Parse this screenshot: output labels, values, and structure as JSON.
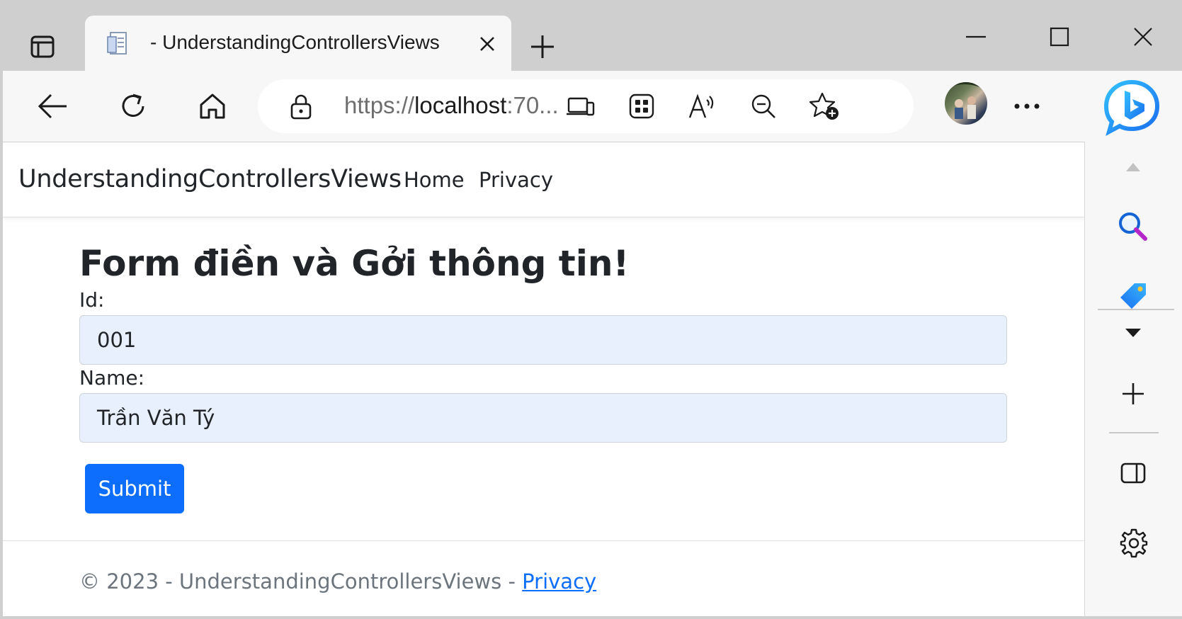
{
  "browser": {
    "tab_title": "- UnderstandingControllersViews",
    "url_scheme": "https://",
    "url_host": "localhost",
    "url_port": ":70...",
    "icons": {
      "tab_actions": "tab-actions-icon",
      "close_tab": "close-icon",
      "new_tab": "plus-icon",
      "minimize": "minimize-icon",
      "maximize": "maximize-icon",
      "close_window": "close-icon",
      "back": "back-arrow-icon",
      "refresh": "refresh-icon",
      "home": "home-icon",
      "lock": "lock-icon",
      "devices": "devices-icon",
      "apps": "apps-grid-icon",
      "read_aloud": "read-aloud-icon",
      "zoom_out": "zoom-out-icon",
      "add_favorite": "add-favorite-icon",
      "more": "more-icon",
      "copilot": "bing-copilot-icon"
    }
  },
  "site": {
    "brand": "UnderstandingControllersViews",
    "nav": [
      {
        "label": "Home"
      },
      {
        "label": "Privacy"
      }
    ]
  },
  "form": {
    "heading": "Form điền và Gởi thông tin!",
    "id_label": "Id:",
    "id_value": "001",
    "name_label": "Name:",
    "name_value": "Trần Văn Tý",
    "submit_label": "Submit"
  },
  "footer": {
    "text": "© 2023 - UnderstandingControllersViews - ",
    "privacy_link": "Privacy"
  },
  "sidebar": {
    "icons": [
      "scroll-up-icon",
      "search-icon",
      "shopping-tag-icon",
      "dropdown-icon",
      "plus-icon",
      "sidebar-panel-icon",
      "settings-icon"
    ]
  },
  "colors": {
    "primary": "#0d6efd",
    "input_autofill": "#e8f0fe",
    "chrome_bg": "#cfcfcf",
    "toolbar_bg": "#f7f7f7"
  }
}
